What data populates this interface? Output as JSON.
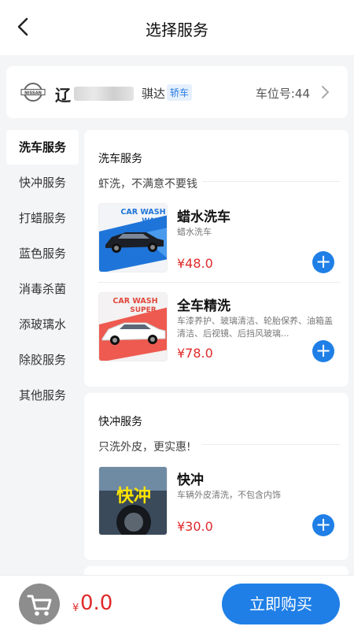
{
  "header": {
    "title": "选择服务"
  },
  "car": {
    "plate_prefix": "辽",
    "model": "骐达",
    "tag": "轿车",
    "slot": "车位号:44",
    "brand": "NISSAN"
  },
  "sidebar": {
    "items": [
      {
        "label": "洗车服务",
        "active": true
      },
      {
        "label": "快冲服务"
      },
      {
        "label": "打蜡服务"
      },
      {
        "label": "蓝色服务"
      },
      {
        "label": "消毒杀菌"
      },
      {
        "label": "添玻璃水"
      },
      {
        "label": "除胶服务"
      },
      {
        "label": "其他服务"
      }
    ]
  },
  "sections": [
    {
      "title": "洗车服务",
      "subtitle": "虾洗，不满意不要钱",
      "items": [
        {
          "name": "蜡水洗车",
          "desc": "蜡水洗车",
          "price": "¥48.0",
          "badge_line1": "CAR WASH",
          "badge_line2": "WAX"
        },
        {
          "name": "全车精洗",
          "desc": "车漆养护、玻璃清洁、轮胎保养、油箱盖清洁、后视镜、后挡风玻璃...",
          "price": "¥78.0",
          "badge_line1": "CAR WASH",
          "badge_line2": "SUPER"
        }
      ]
    },
    {
      "title": "快冲服务",
      "subtitle": "只洗外皮，更实惠!",
      "items": [
        {
          "name": "快冲",
          "desc": "车辆外皮清洗，不包含内饰",
          "price": "¥30.0",
          "badge_line1": "快冲"
        }
      ]
    }
  ],
  "footer": {
    "currency": "¥",
    "total": "0.0",
    "buy_label": "立即购买"
  },
  "colors": {
    "accent": "#1f7fe6",
    "price": "#e02a2a"
  }
}
